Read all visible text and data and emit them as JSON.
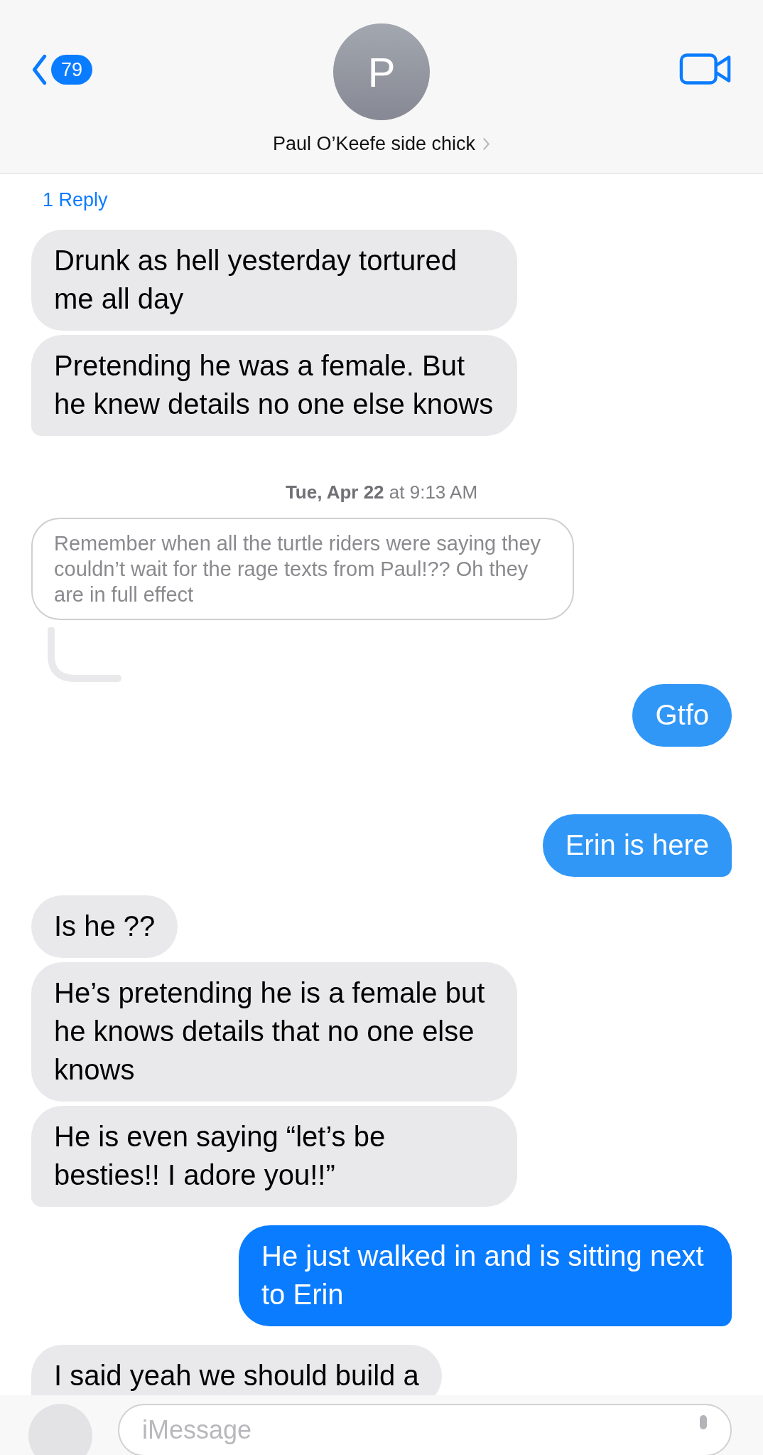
{
  "header": {
    "back_count": "79",
    "avatar_initial": "P",
    "contact_name": "Paul O’Keefe side chick"
  },
  "messages": [
    {
      "kind": "reply_count",
      "text": "1 Reply"
    },
    {
      "kind": "received",
      "text": "Drunk as hell yesterday tortured me all day"
    },
    {
      "kind": "received",
      "text": "Pretending he was a female. But he knew details no one else knows"
    },
    {
      "kind": "timestamp",
      "text": "**Tue, Apr 22** at 9:13 AM"
    },
    {
      "kind": "reply_preview",
      "text": "Remember when all the turtle riders were saying they couldn’t wait for the rage texts from Paul!?? Oh they are in full effect"
    },
    {
      "kind": "sent",
      "text": "Gtfo",
      "color": "#3197f7"
    },
    {
      "kind": "sent",
      "text": "Erin is here",
      "color": "#3197f7"
    },
    {
      "kind": "received",
      "text": "Is he ??"
    },
    {
      "kind": "received",
      "text": "He’s pretending he is a female but he knows details that no one else knows"
    },
    {
      "kind": "received",
      "text": "He is even saying “let’s be besties!! I adore you!!”"
    },
    {
      "kind": "sent",
      "text": "He just walked in and is sitting next to Erin",
      "color": "#0a7cff"
    },
    {
      "kind": "received",
      "text": "I said yeah we should build a"
    }
  ],
  "composer": {
    "placeholder": "iMessage"
  }
}
